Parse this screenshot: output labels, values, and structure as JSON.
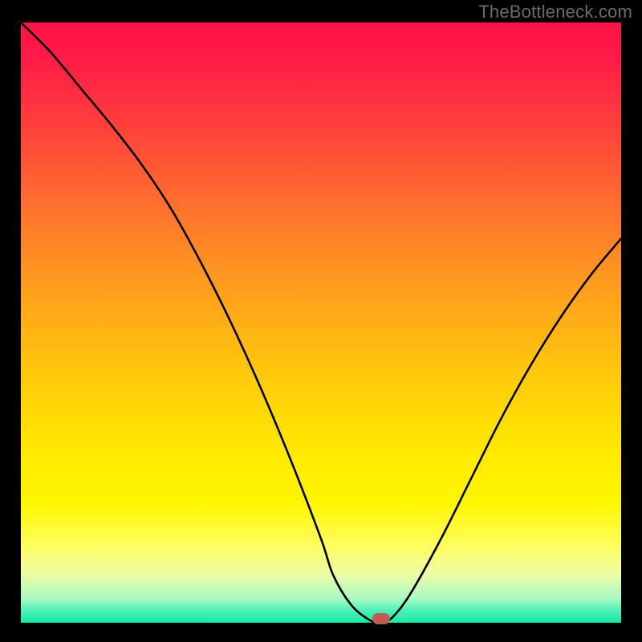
{
  "attribution": "TheBottleneck.com",
  "chart_data": {
    "type": "line",
    "title": "",
    "xlabel": "",
    "ylabel": "",
    "xlim": [
      0,
      100
    ],
    "ylim": [
      0,
      100
    ],
    "series": [
      {
        "name": "bottleneck-curve",
        "x": [
          0,
          5,
          10,
          15,
          20,
          25,
          30,
          35,
          40,
          45,
          50,
          52,
          55,
          58,
          60,
          62,
          65,
          70,
          75,
          80,
          85,
          90,
          95,
          100
        ],
        "y": [
          100,
          95,
          89,
          83,
          76.5,
          69,
          60,
          50,
          39,
          27,
          14,
          8,
          3,
          0.5,
          0,
          1,
          5,
          14,
          24,
          34,
          43,
          51,
          58,
          64
        ]
      }
    ],
    "annotations": [
      {
        "name": "optimal-point",
        "x": 60,
        "y": 0.7
      }
    ],
    "gradient_stops": [
      {
        "pct": 0,
        "color": "#ff1247"
      },
      {
        "pct": 50,
        "color": "#ffb513"
      },
      {
        "pct": 80,
        "color": "#fff600"
      },
      {
        "pct": 100,
        "color": "#17e9a8"
      }
    ]
  }
}
